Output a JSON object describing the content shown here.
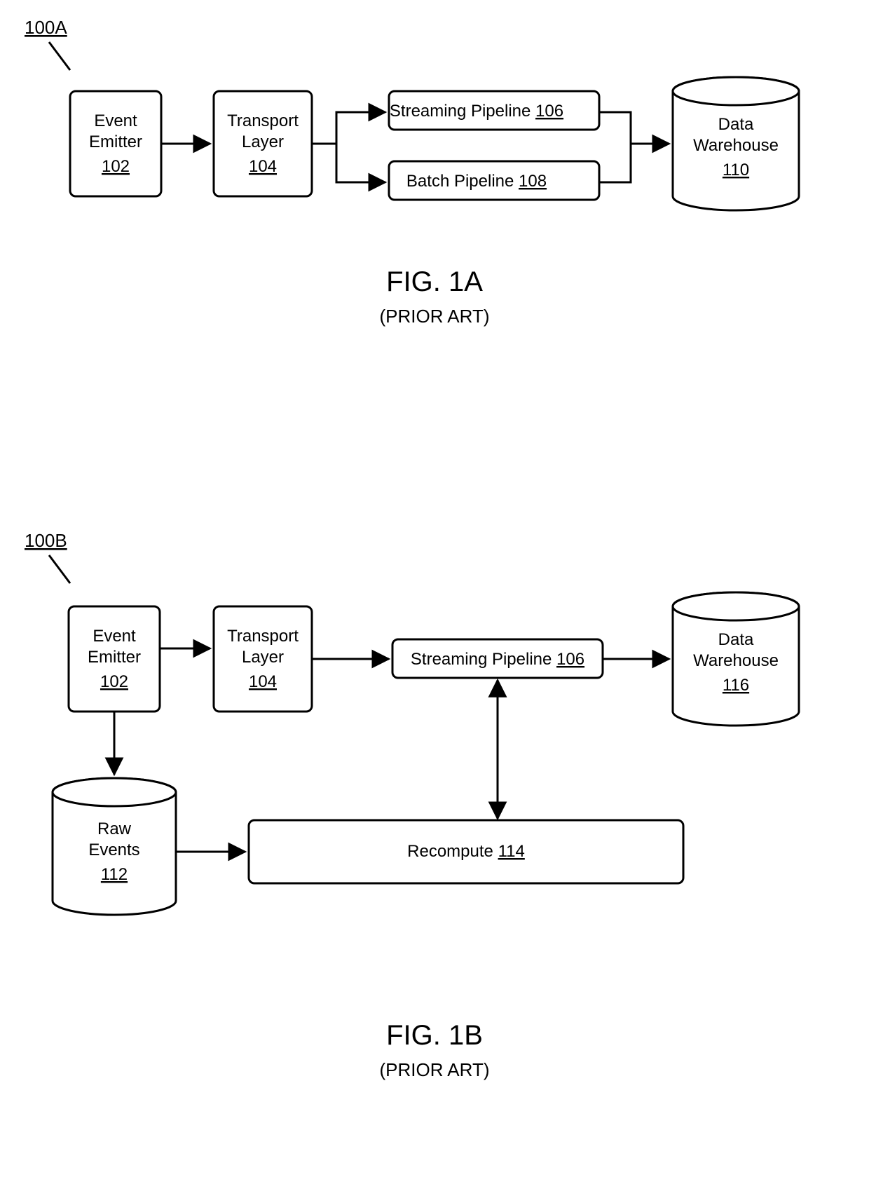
{
  "figA": {
    "ref": "100A",
    "title": "FIG. 1A",
    "subtitle": "(PRIOR ART)",
    "boxes": {
      "emitter": {
        "line1": "Event",
        "line2": "Emitter",
        "num": "102"
      },
      "transport": {
        "line1": "Transport",
        "line2": "Layer",
        "num": "104"
      },
      "stream": {
        "label": "Streaming Pipeline",
        "num": "106"
      },
      "batch": {
        "label": "Batch Pipeline",
        "num": "108"
      },
      "warehouse": {
        "line1": "Data",
        "line2": "Warehouse",
        "num": "110"
      }
    }
  },
  "figB": {
    "ref": "100B",
    "title": "FIG. 1B",
    "subtitle": "(PRIOR ART)",
    "boxes": {
      "emitter": {
        "line1": "Event",
        "line2": "Emitter",
        "num": "102"
      },
      "transport": {
        "line1": "Transport",
        "line2": "Layer",
        "num": "104"
      },
      "stream": {
        "label": "Streaming Pipeline",
        "num": "106"
      },
      "warehouse": {
        "line1": "Data",
        "line2": "Warehouse",
        "num": "116"
      },
      "raw": {
        "line1": "Raw",
        "line2": "Events",
        "num": "112"
      },
      "recompute": {
        "label": "Recompute",
        "num": "114"
      }
    }
  }
}
